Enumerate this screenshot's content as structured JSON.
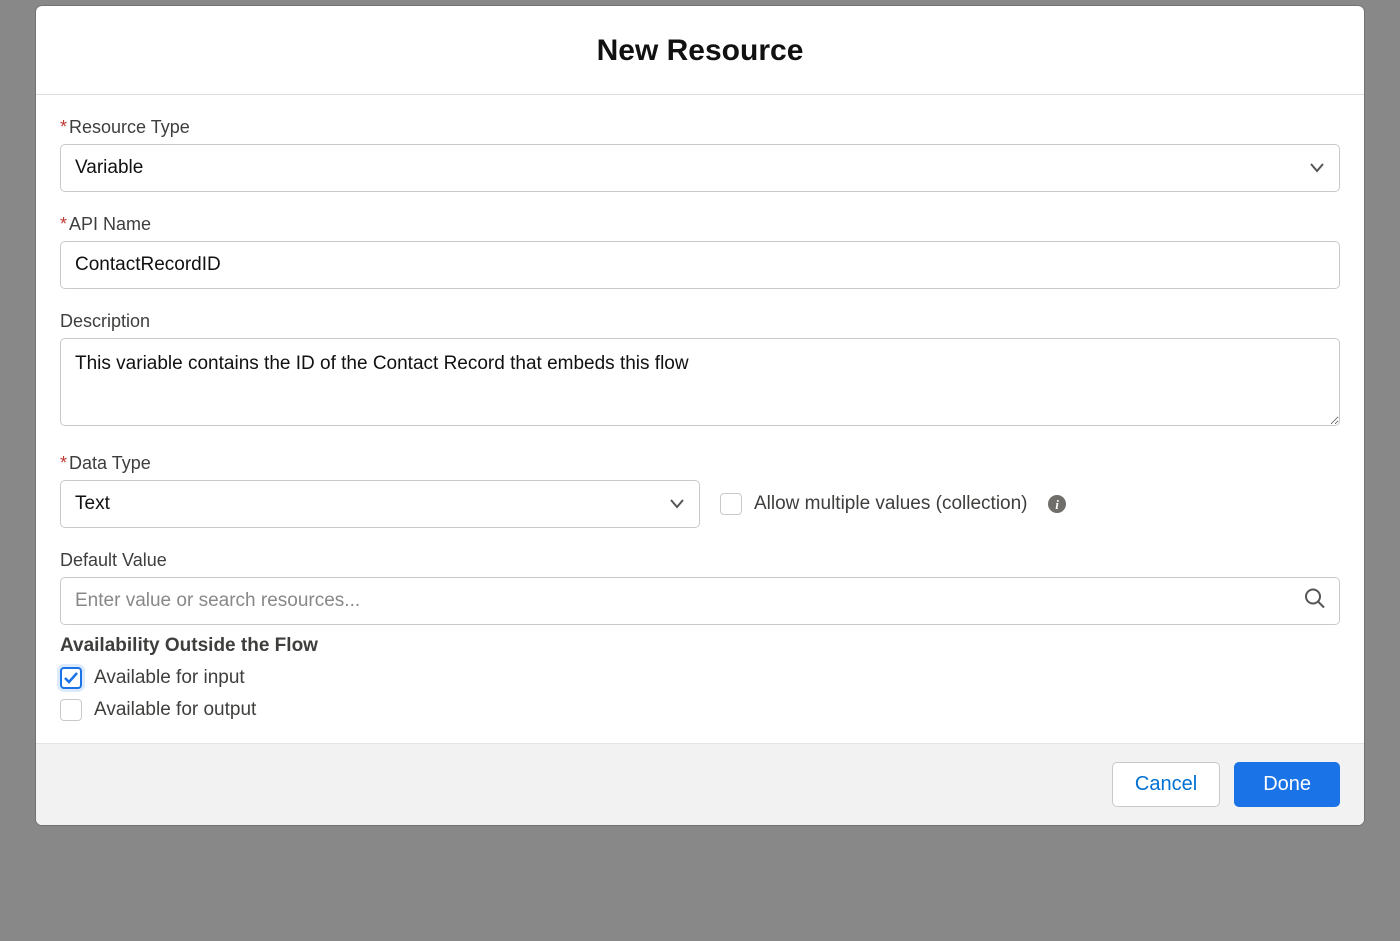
{
  "header": {
    "title": "New Resource"
  },
  "fields": {
    "resource_type": {
      "label": "Resource Type",
      "value": "Variable"
    },
    "api_name": {
      "label": "API Name",
      "value": "ContactRecordID"
    },
    "description": {
      "label": "Description",
      "value": "This variable contains the ID of the Contact Record that embeds this flow"
    },
    "data_type": {
      "label": "Data Type",
      "value": "Text"
    },
    "allow_multiple": {
      "label": "Allow multiple values (collection)",
      "checked": false
    },
    "default_value": {
      "label": "Default Value",
      "placeholder": "Enter value or search resources..."
    },
    "availability": {
      "section_title": "Availability Outside the Flow",
      "input": {
        "label": "Available for input",
        "checked": true
      },
      "output": {
        "label": "Available for output",
        "checked": false
      }
    }
  },
  "footer": {
    "cancel": "Cancel",
    "done": "Done"
  }
}
